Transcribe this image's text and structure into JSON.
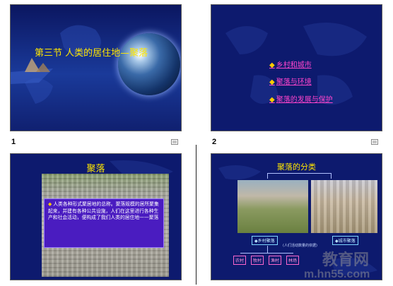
{
  "slides": [
    {
      "number": "1",
      "title": "第三节  人类的居住地—聚落"
    },
    {
      "number": "2",
      "links": [
        "乡村和城市",
        "聚落与环境",
        "聚落的发展与保护"
      ]
    },
    {
      "number": "",
      "title": "聚落",
      "body": "人类各种形式聚居地的总称。聚落规模的居所聚集起来，并建有各种公共设施，人们在这里进行各种生产和社会活动，便构成了我们人类的居住地——聚落"
    },
    {
      "number": "",
      "title": "聚落的分类",
      "categories": [
        "乡村聚落",
        "城市聚落"
      ],
      "caption": "(人们活动数量的依据)",
      "sub_types": [
        "农村",
        "牧村",
        "渔村",
        "林场"
      ]
    }
  ],
  "watermark": {
    "main": "教育网",
    "sub": "m.hn55.com"
  }
}
